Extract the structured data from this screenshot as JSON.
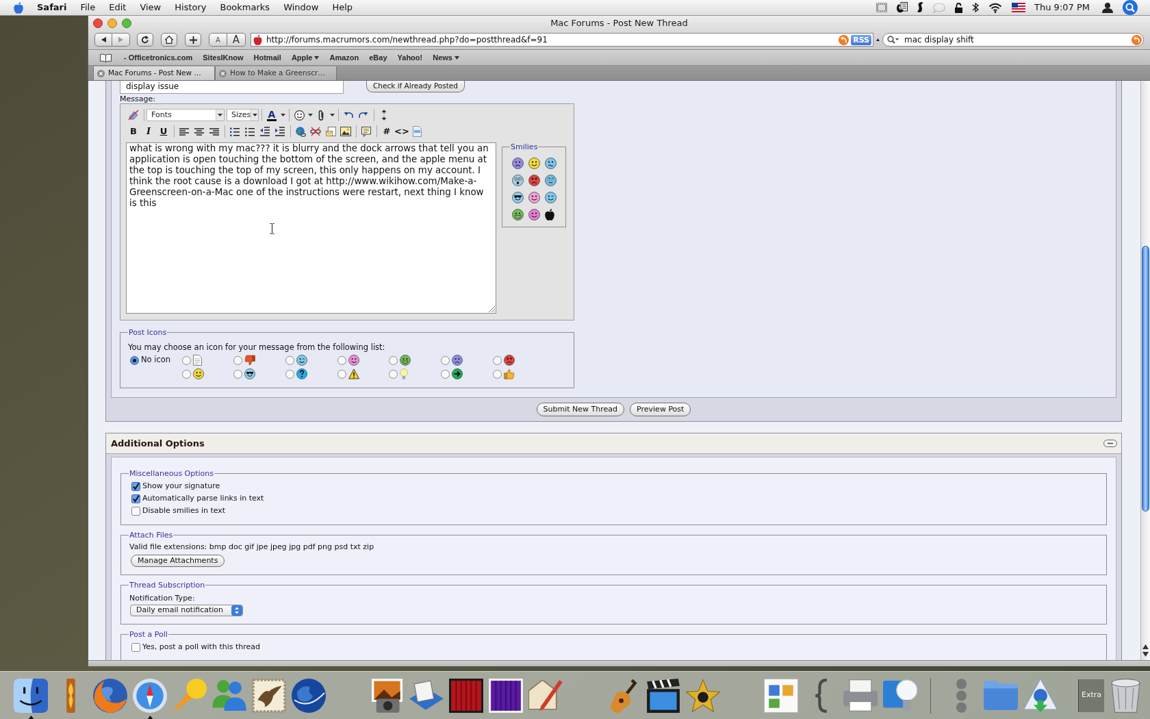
{
  "menu_bar": {
    "app": "Safari",
    "menus": [
      "File",
      "Edit",
      "View",
      "History",
      "Bookmarks",
      "Window",
      "Help"
    ],
    "clock": "Thu 9:07 PM"
  },
  "window": {
    "title": "Mac Forums - Post New Thread",
    "toolbar": {
      "text_size_buttons": [
        "A",
        "A"
      ],
      "address": "http://forums.macrumors.com/newthread.php?do=postthread&f=91",
      "rss_button": "RSS",
      "search": "mac display shift"
    },
    "bookmarks": [
      {
        "label": "- Officetronics.com",
        "menu": false
      },
      {
        "label": "SitesIKnow",
        "menu": false
      },
      {
        "label": "Hotmail",
        "menu": false
      },
      {
        "label": "Apple",
        "menu": true
      },
      {
        "label": "Amazon",
        "menu": false
      },
      {
        "label": "eBay",
        "menu": false
      },
      {
        "label": "Yahoo!",
        "menu": false
      },
      {
        "label": "News",
        "menu": true
      }
    ],
    "tabs": [
      {
        "label": "Mac Forums - Post New …",
        "selected": true
      },
      {
        "label": "How to Make a Greenscr…",
        "selected": false
      }
    ]
  },
  "post_form": {
    "title_value": "display issue",
    "check_button": "Check if Already Posted",
    "message_label": "Message:",
    "editor": {
      "font_select": "Fonts",
      "size_select": "Sizes",
      "color_button": "A",
      "style_buttons": [
        "B",
        "I",
        "U"
      ],
      "code_buttons": [
        "#",
        "<>"
      ],
      "message": "what is wrong with my mac??? it is blurry and the dock arrows that tell you an application is open touching the bottom of the screen, and the apple menu at the top is touching the top of my screen, this only happens on my account. I think the root cause is a download I got at http://www.wikihow.com/Make-a-Greenscreen-on-a-Mac one of the instructions were restart, next thing I know is this",
      "smilies_legend": "Smilies"
    },
    "post_icons": {
      "legend": "Post Icons",
      "instruction": "You may choose an icon for your message from the following list:",
      "options": [
        {
          "kind": "none",
          "label": "No icon",
          "selected": true
        },
        {
          "kind": "page",
          "selected": false
        },
        {
          "kind": "thumbs-down",
          "selected": false
        },
        {
          "kind": "wink",
          "selected": false
        },
        {
          "kind": "pink-smile",
          "selected": false
        },
        {
          "kind": "grin",
          "selected": false
        },
        {
          "kind": "frown",
          "selected": false
        },
        {
          "kind": "angry",
          "selected": false
        },
        {
          "kind": "smile",
          "selected": false
        },
        {
          "kind": "cool",
          "selected": false
        },
        {
          "kind": "question",
          "selected": false
        },
        {
          "kind": "warning",
          "selected": false
        },
        {
          "kind": "bulb",
          "selected": false
        },
        {
          "kind": "arrow",
          "selected": false
        },
        {
          "kind": "thumbs-up",
          "selected": false
        }
      ]
    },
    "buttons": [
      "Submit New Thread",
      "Preview Post"
    ]
  },
  "additional_options": {
    "title": "Additional Options",
    "fieldsets": [
      {
        "kind": "checkboxes",
        "legend": "Miscellaneous Options",
        "options": [
          {
            "label": "Show your signature",
            "checked": true
          },
          {
            "label": "Automatically parse links in text",
            "checked": true
          },
          {
            "label": "Disable smilies in text",
            "checked": false
          }
        ]
      },
      {
        "kind": "attachments",
        "legend": "Attach Files",
        "text": "Valid file extensions: bmp doc gif jpe jpeg jpg pdf png psd txt zip",
        "button": "Manage Attachments"
      },
      {
        "kind": "select",
        "legend": "Thread Subscription",
        "label": "Notification Type:",
        "value": "Daily email notification"
      },
      {
        "kind": "checkboxes",
        "legend": "Post a Poll",
        "options": [
          {
            "label": "Yes, post a poll with this thread",
            "checked": false
          }
        ]
      }
    ]
  },
  "dock": {
    "apps": [
      [
        {
          "kind": "face",
          "running": true
        },
        {
          "kind": "flame",
          "running": false
        },
        {
          "kind": "fox",
          "running": false
        },
        {
          "kind": "compass",
          "running": true
        },
        {
          "kind": "comet",
          "running": false
        },
        {
          "kind": "people",
          "running": false
        },
        {
          "kind": "stamp",
          "running": false
        },
        {
          "kind": "earth",
          "running": false
        }
      ],
      [
        {
          "kind": "camera",
          "running": false
        },
        {
          "kind": "scanner",
          "running": false
        },
        {
          "kind": "curtain",
          "running": false
        },
        {
          "kind": "drape",
          "running": false
        },
        {
          "kind": "pencil",
          "running": false
        }
      ],
      [
        {
          "kind": "guitar",
          "running": false
        },
        {
          "kind": "clapper",
          "running": false
        },
        {
          "kind": "star",
          "running": false
        }
      ],
      [
        {
          "kind": "box",
          "running": false
        },
        {
          "kind": "brace",
          "running": false
        },
        {
          "kind": "printer",
          "running": false
        },
        {
          "kind": "bulb",
          "running": false
        }
      ]
    ],
    "others": [
      {
        "kind": "dots"
      },
      {
        "kind": "folder"
      },
      {
        "kind": "download"
      },
      {
        "kind": "stack",
        "label": "Extra"
      },
      {
        "kind": "trash"
      }
    ]
  }
}
